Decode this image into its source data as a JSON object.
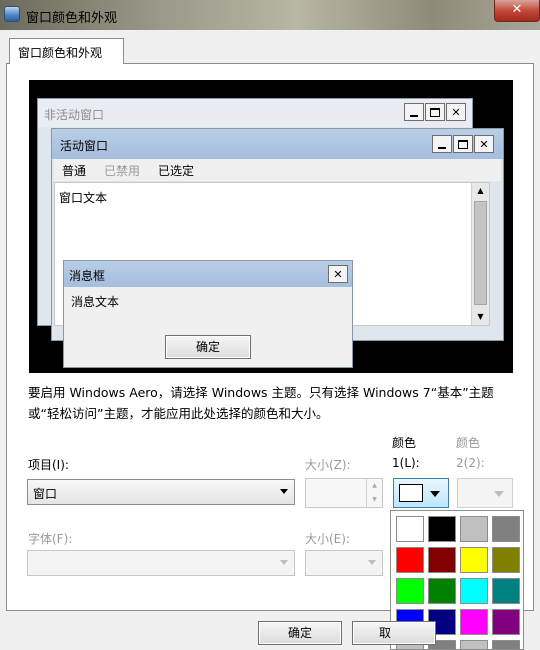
{
  "window": {
    "title": "窗口颜色和外观",
    "close_glyph": "✕"
  },
  "tab": {
    "label": "窗口颜色和外观"
  },
  "preview": {
    "inactive_title": "非活动窗口",
    "active_title": "活动窗口",
    "menu": [
      "普通",
      "已禁用",
      "已选定"
    ],
    "window_text": "窗口文本",
    "msgbox_title": "消息框",
    "msgbox_text": "消息文本",
    "msgbox_ok": "确定"
  },
  "info_text": "要启用 Windows Aero，请选择 Windows 主题。只有选择 Windows 7“基本”主题或“轻松访问”主题，才能应用此处选择的颜色和大小。",
  "item": {
    "label": "项目(I):",
    "value": "窗口"
  },
  "item_size": {
    "label": "大小(Z):"
  },
  "color1": {
    "label_top": "颜色",
    "label": "1(L):",
    "value": "#ffffff"
  },
  "color2": {
    "label_top": "颜色",
    "label": "2(2):"
  },
  "font": {
    "label": "字体(F):",
    "value": ""
  },
  "font_size": {
    "label": "大小(E):"
  },
  "palette_colors": [
    "#ffffff",
    "#000000",
    "#c0c0c0",
    "#808080",
    "#ff0000",
    "#800000",
    "#ffff00",
    "#808000",
    "#00ff00",
    "#008000",
    "#00ffff",
    "#008080",
    "#0000ff",
    "#000080",
    "#ff00ff",
    "#800080",
    "#c0c0c0",
    "#808080",
    "#c0c0c0",
    "#808080"
  ],
  "buttons": {
    "ok": "确定",
    "cancel": "取"
  }
}
